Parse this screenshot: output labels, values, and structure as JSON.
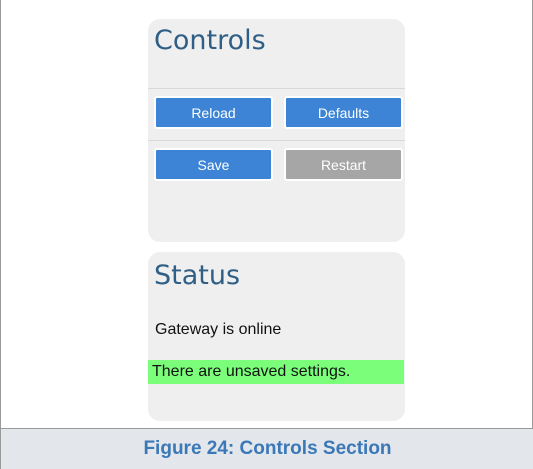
{
  "controls": {
    "title": "Controls",
    "buttons": {
      "reload": "Reload",
      "defaults": "Defaults",
      "save": "Save",
      "restart": "Restart"
    }
  },
  "status": {
    "title": "Status",
    "gateway_text": "Gateway is online",
    "unsaved_text": "There are unsaved settings.",
    "unsaved_color": "#7bff7b"
  },
  "caption": "Figure 24: Controls Section",
  "colors": {
    "title": "#2f5f86",
    "button_active": "#3d84d6",
    "button_disabled": "#a6a6a6",
    "caption_text": "#3a78b8"
  }
}
